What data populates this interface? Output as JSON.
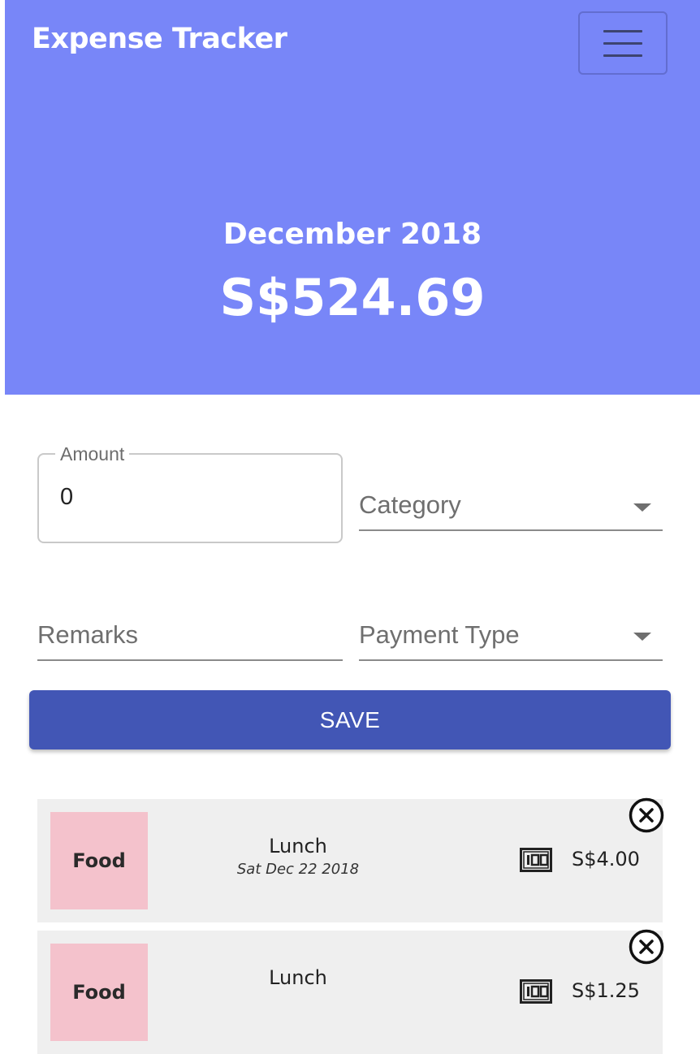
{
  "header": {
    "title": "Expense Tracker",
    "menu_icon": "hamburger-menu-icon"
  },
  "summary": {
    "month": "December 2018",
    "total": "S$524.69"
  },
  "form": {
    "amount_label": "Amount",
    "amount_value": "0",
    "category_placeholder": "Category",
    "remarks_placeholder": "Remarks",
    "payment_type_placeholder": "Payment Type",
    "save_label": "SAVE"
  },
  "expenses": [
    {
      "category": "Food",
      "remark": "Lunch",
      "date": "Sat Dec 22 2018",
      "payment_icon": "cash-icon",
      "amount": "S$4.00"
    },
    {
      "category": "Food",
      "remark": "Lunch",
      "date": "",
      "payment_icon": "cash-icon",
      "amount": "S$1.25"
    }
  ],
  "colors": {
    "hero": "#7886f8",
    "save_button": "#4256b5",
    "category_food": "#f4c2cc",
    "list_item_bg": "#efefef"
  }
}
